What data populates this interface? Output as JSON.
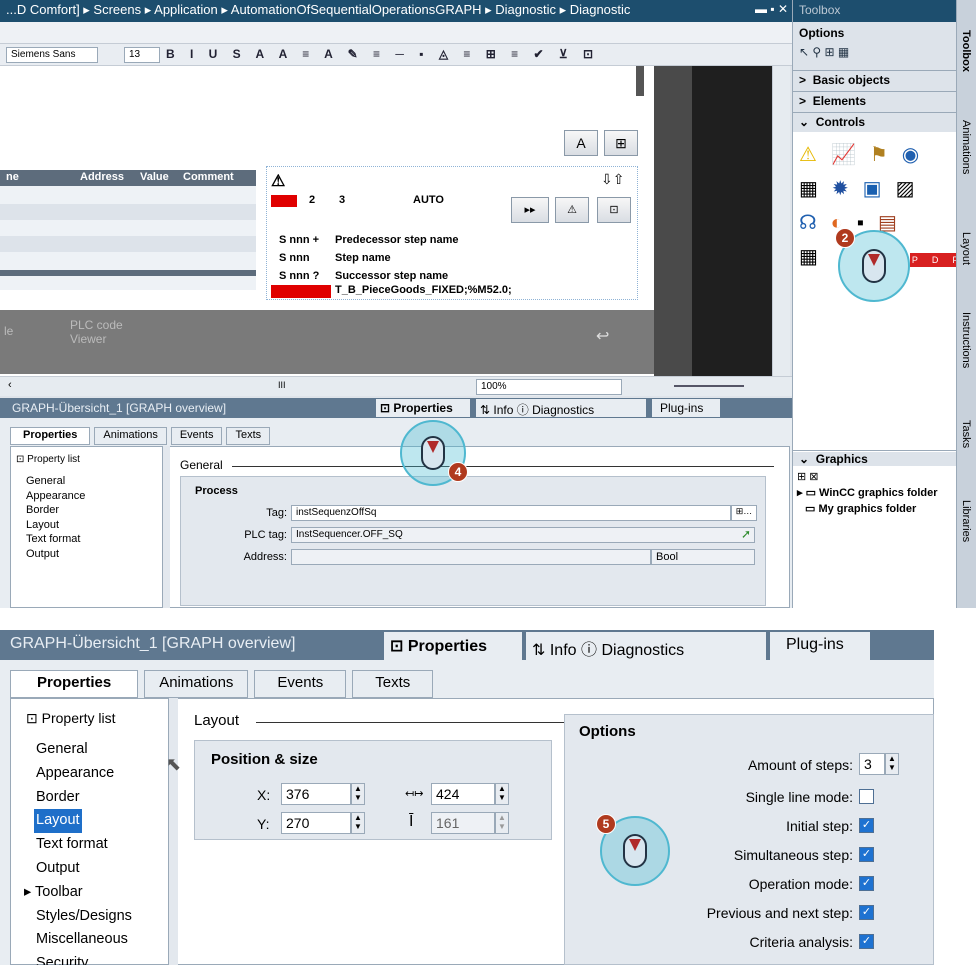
{
  "top": {
    "breadcrumb": "...D Comfort] ▸ Screens ▸ Application ▸ AutomationOfSequentialOperationsGRAPH ▸ Diagnostic ▸ Diagnostic",
    "font_name": "Siemens Sans",
    "font_size": "13",
    "table_headers": [
      "ne",
      "Address",
      "Value",
      "Comment"
    ],
    "graph": {
      "steps": [
        "2",
        "3"
      ],
      "mode": "AUTO",
      "rows": [
        {
          "code": "S nnn +",
          "text": "Predecessor step name"
        },
        {
          "code": "S nnn",
          "text": "Step name"
        },
        {
          "code": "S nnn ?",
          "text": "Successor step name"
        }
      ],
      "tag_line": "T_B_PieceGoods_FIXED;%M52.0;"
    },
    "plc_viewer": "PLC code Viewer",
    "plc_left": "le",
    "zoom": "100%",
    "scroll_mark": "III",
    "toolbox": {
      "title": "Toolbox",
      "options": "Options",
      "basic": "Basic objects",
      "elements": "Elements",
      "controls": "Controls",
      "graphics": "Graphics",
      "folders": [
        "WinCC graphics folder",
        "My graphics folder"
      ],
      "pdf": "PDF"
    },
    "sidetabs": [
      "Toolbox",
      "Animations",
      "Layout",
      "Instructions",
      "Tasks",
      "Libraries"
    ],
    "inspector_title": "GRAPH-Übersicht_1 [GRAPH overview]",
    "inspector_tabs": [
      "Properties",
      "Info",
      "Diagnostics",
      "Plug-ins"
    ],
    "subtabs": [
      "Properties",
      "Animations",
      "Events",
      "Texts"
    ],
    "property_list": "Property list",
    "nav": [
      "General",
      "Appearance",
      "Border",
      "Layout",
      "Text format",
      "Output"
    ],
    "section": "General",
    "group": "Process",
    "fields": [
      {
        "label": "Tag:",
        "value": "instSequenzOffSq"
      },
      {
        "label": "PLC tag:",
        "value": "InstSequencer.OFF_SQ"
      },
      {
        "label": "Address:",
        "value": "",
        "type": "Bool"
      }
    ],
    "badges": [
      "2",
      "4"
    ]
  },
  "bottom": {
    "inspector_title": "GRAPH-Übersicht_1 [GRAPH overview]",
    "inspector_tabs": [
      "Properties",
      "Info",
      "Diagnostics",
      "Plug-ins"
    ],
    "subtabs": [
      "Properties",
      "Animations",
      "Events",
      "Texts"
    ],
    "property_list": "Property list",
    "nav": [
      "General",
      "Appearance",
      "Border",
      "Layout",
      "Text format",
      "Output",
      "Toolbar",
      "Styles/Designs",
      "Miscellaneous",
      "Security"
    ],
    "section": "Layout",
    "pos_group": "Position & size",
    "x": "376",
    "y": "270",
    "w": "424",
    "h": "161",
    "options_group": "Options",
    "options": [
      {
        "label": "Amount of steps:",
        "value": "3"
      },
      {
        "label": "Single line mode:",
        "checked": false
      },
      {
        "label": "Initial step:",
        "checked": true
      },
      {
        "label": "Simultaneous step:",
        "checked": true
      },
      {
        "label": "Operation mode:",
        "checked": true
      },
      {
        "label": "Previous and next step:",
        "checked": true
      },
      {
        "label": "Criteria analysis:",
        "checked": true
      }
    ],
    "badge": "5"
  }
}
